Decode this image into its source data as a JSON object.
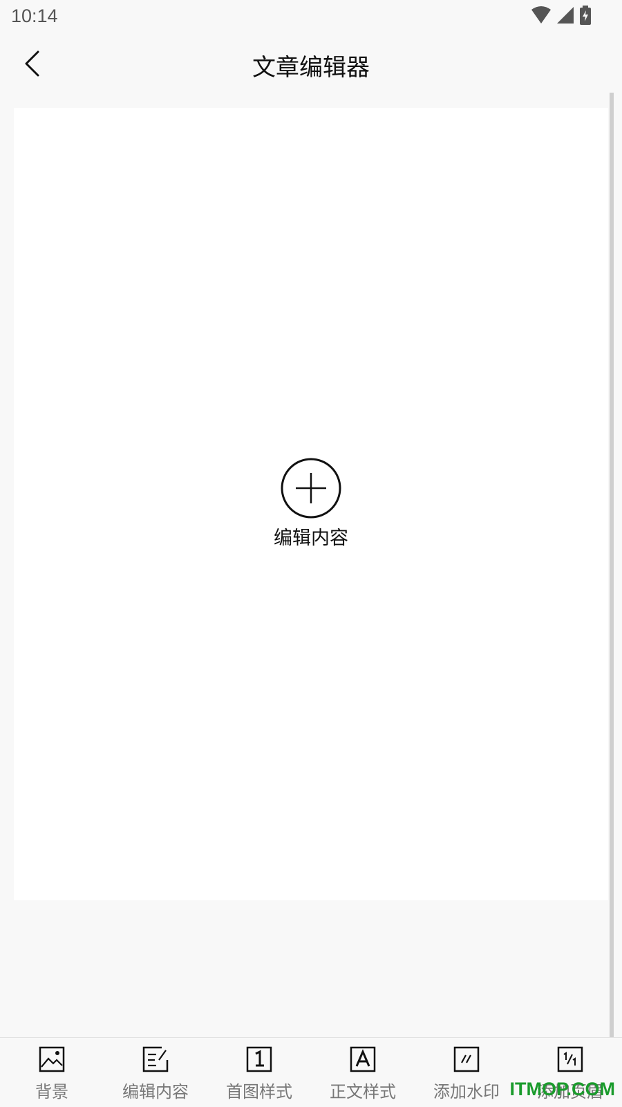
{
  "status_bar": {
    "time": "10:14",
    "icons": [
      "wifi-icon",
      "signal-icon",
      "battery-charging-icon"
    ]
  },
  "header": {
    "back_icon": "chevron-left-icon",
    "title": "文章编辑器"
  },
  "canvas": {
    "add_icon": "plus-circle-icon",
    "add_label": "编辑内容"
  },
  "toolbar": {
    "items": [
      {
        "label": "背景",
        "icon": "image-icon"
      },
      {
        "label": "编辑内容",
        "icon": "edit-note-icon"
      },
      {
        "label": "首图样式",
        "icon": "number-one-icon"
      },
      {
        "label": "正文样式",
        "icon": "letter-a-icon"
      },
      {
        "label": "添加水印",
        "icon": "watermark-slash-icon"
      },
      {
        "label": "添加页眉",
        "icon": "fraction-icon"
      }
    ]
  },
  "watermark": {
    "text": "ITMOP.COM",
    "color": "#1a9b2c"
  }
}
